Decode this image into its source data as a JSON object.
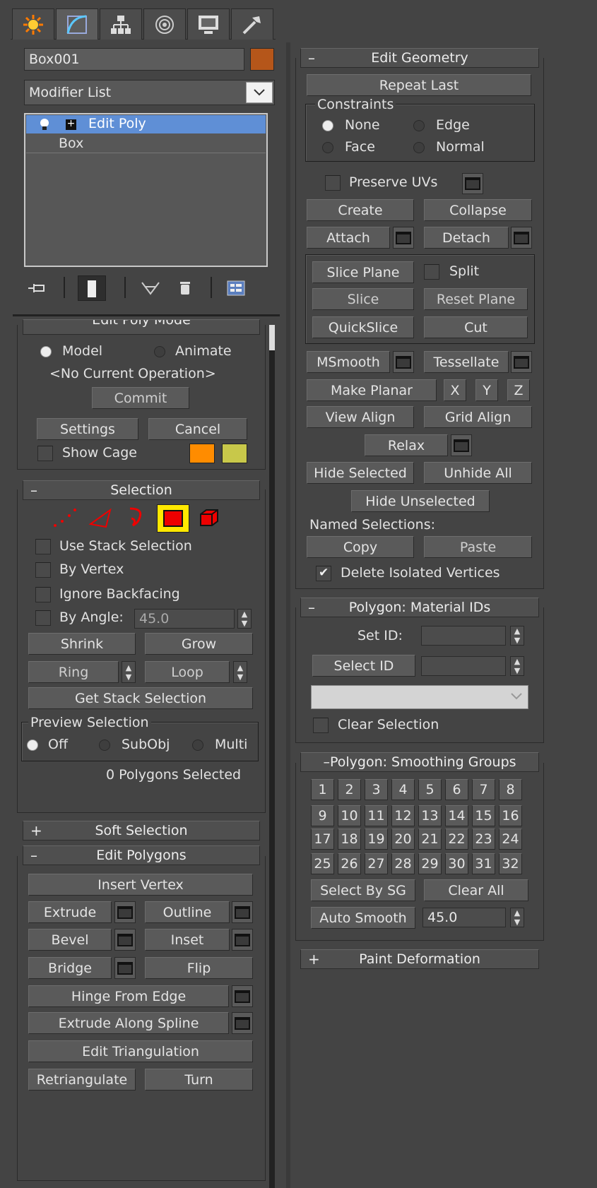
{
  "object": {
    "name": "Box001",
    "color": "#b5561a"
  },
  "modifier_list": {
    "label": "Modifier List"
  },
  "stack": {
    "items": [
      "Edit Poly",
      "Box"
    ]
  },
  "edit_poly_mode": {
    "title": "Edit Poly Mode",
    "model": "Model",
    "animate": "Animate",
    "current_op": "<No Current Operation>",
    "commit": "Commit",
    "settings": "Settings",
    "cancel": "Cancel",
    "show_cage": "Show Cage",
    "cage_colors": [
      "#ff8c00",
      "#c8c84a"
    ]
  },
  "selection": {
    "title": "Selection",
    "use_stack": "Use Stack Selection",
    "by_vertex": "By Vertex",
    "ignore_backfacing": "Ignore Backfacing",
    "by_angle": "By Angle:",
    "by_angle_value": "45.0",
    "shrink": "Shrink",
    "grow": "Grow",
    "ring": "Ring",
    "loop": "Loop",
    "get_stack": "Get Stack Selection",
    "preview_title": "Preview Selection",
    "off": "Off",
    "subobj": "SubObj",
    "multi": "Multi",
    "status": "0 Polygons Selected"
  },
  "soft_selection": {
    "title": "Soft Selection",
    "sign": "+"
  },
  "edit_polygons": {
    "title": "Edit Polygons",
    "insert_vertex": "Insert Vertex",
    "extrude": "Extrude",
    "outline": "Outline",
    "bevel": "Bevel",
    "inset": "Inset",
    "bridge": "Bridge",
    "flip": "Flip",
    "hinge": "Hinge From Edge",
    "extrude_spline": "Extrude Along Spline",
    "edit_tri": "Edit Triangulation",
    "retriangulate": "Retriangulate",
    "turn": "Turn"
  },
  "edit_geometry": {
    "title": "Edit Geometry",
    "repeat_last": "Repeat Last",
    "constraints": "Constraints",
    "none": "None",
    "edge": "Edge",
    "face": "Face",
    "normal": "Normal",
    "preserve_uvs": "Preserve UVs",
    "create": "Create",
    "collapse": "Collapse",
    "attach": "Attach",
    "detach": "Detach",
    "slice_plane": "Slice Plane",
    "split": "Split",
    "slice": "Slice",
    "reset_plane": "Reset Plane",
    "quickslice": "QuickSlice",
    "cut": "Cut",
    "msmooth": "MSmooth",
    "tessellate": "Tessellate",
    "make_planar": "Make Planar",
    "x": "X",
    "y": "Y",
    "z": "Z",
    "view_align": "View Align",
    "grid_align": "Grid Align",
    "relax": "Relax",
    "hide_selected": "Hide Selected",
    "unhide_all": "Unhide All",
    "hide_unselected": "Hide Unselected",
    "named_selections": "Named Selections:",
    "copy": "Copy",
    "paste": "Paste",
    "delete_isolated": "Delete Isolated Vertices"
  },
  "material_ids": {
    "title": "Polygon: Material IDs",
    "set_id": "Set ID:",
    "select_id": "Select ID",
    "clear_selection": "Clear Selection"
  },
  "smoothing": {
    "title": "Polygon: Smoothing Groups",
    "groups": [
      "1",
      "2",
      "3",
      "4",
      "5",
      "6",
      "7",
      "8",
      "9",
      "10",
      "11",
      "12",
      "13",
      "14",
      "15",
      "16",
      "17",
      "18",
      "19",
      "20",
      "21",
      "22",
      "23",
      "24",
      "25",
      "26",
      "27",
      "28",
      "29",
      "30",
      "31",
      "32"
    ],
    "select_by_sg": "Select By SG",
    "clear_all": "Clear All",
    "auto_smooth": "Auto Smooth",
    "auto_smooth_value": "45.0"
  },
  "paint_deformation": {
    "title": "Paint Deformation",
    "sign": "+"
  },
  "signs": {
    "minus": "–"
  }
}
